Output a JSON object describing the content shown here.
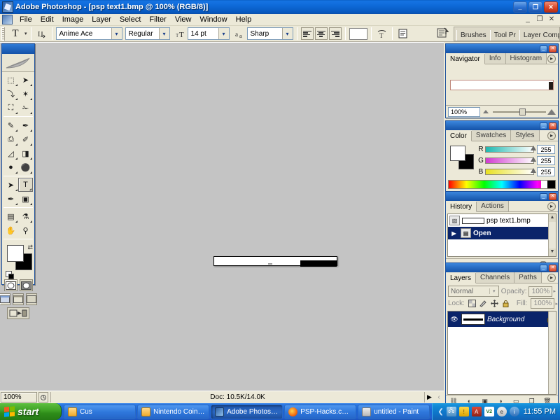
{
  "window": {
    "title": "Adobe Photoshop - [psp text1.bmp @ 100% (RGB/8)]",
    "app_icon": "photoshop-icon",
    "minimize": "_",
    "restore": "❐",
    "close": "✕"
  },
  "menubar": {
    "doc_icon": "document-icon",
    "items": [
      "File",
      "Edit",
      "Image",
      "Layer",
      "Select",
      "Filter",
      "View",
      "Window",
      "Help"
    ],
    "doc_minimize": "_",
    "doc_restore": "❐",
    "doc_close": "✕"
  },
  "options_bar": {
    "tool_glyph": "T",
    "tool_caret": "▾",
    "orientation_icon": "text-orientation-icon",
    "font_family": "Anime Ace",
    "font_style": "Regular",
    "size_icon": "font-size-icon",
    "font_size": "14 pt",
    "aa_icon": "anti-alias-icon",
    "anti_alias": "Sharp",
    "align_left": "align-left",
    "align_center": "align-center",
    "align_right": "align-right",
    "text_color": "#ffffff",
    "warp_icon": "warp-text-icon",
    "palette_icon": "character-palette-icon",
    "dock_icon": "dock-to-well-icon",
    "well_tabs": [
      "Brushes",
      "Tool Pr",
      "Layer Comps"
    ],
    "dropdown_arrow": "▾"
  },
  "toolbox": {
    "logo": "feather-logo",
    "tools": [
      {
        "name": "marquee-tool",
        "glyph": "⬚",
        "selected": false
      },
      {
        "name": "move-tool",
        "glyph": "➤",
        "selected": false
      },
      {
        "name": "lasso-tool",
        "glyph": "⤵",
        "selected": false
      },
      {
        "name": "magic-wand-tool",
        "glyph": "✶",
        "selected": false
      },
      {
        "name": "crop-tool",
        "glyph": "⛶",
        "selected": false
      },
      {
        "name": "slice-tool",
        "glyph": "✁",
        "selected": false
      },
      {
        "name": "healing-brush-tool",
        "glyph": "✎",
        "selected": false
      },
      {
        "name": "brush-tool",
        "glyph": "✒",
        "selected": false
      },
      {
        "name": "clone-stamp-tool",
        "glyph": "⎙",
        "selected": false
      },
      {
        "name": "history-brush-tool",
        "glyph": "✐",
        "selected": false
      },
      {
        "name": "eraser-tool",
        "glyph": "◿",
        "selected": false
      },
      {
        "name": "gradient-tool",
        "glyph": "◨",
        "selected": false
      },
      {
        "name": "blur-tool",
        "glyph": "●",
        "selected": false
      },
      {
        "name": "dodge-tool",
        "glyph": "⚫",
        "selected": false
      },
      {
        "name": "path-selection-tool",
        "glyph": "➤",
        "selected": false
      },
      {
        "name": "type-tool",
        "glyph": "T",
        "selected": true
      },
      {
        "name": "pen-tool",
        "glyph": "✒",
        "selected": false
      },
      {
        "name": "shape-tool",
        "glyph": "▣",
        "selected": false
      },
      {
        "name": "notes-tool",
        "glyph": "▤",
        "selected": false
      },
      {
        "name": "eyedropper-tool",
        "glyph": "⚗",
        "selected": false
      },
      {
        "name": "hand-tool",
        "glyph": "✋",
        "selected": false
      },
      {
        "name": "zoom-tool",
        "glyph": "⚲",
        "selected": false
      }
    ],
    "foreground_color": "#ffffff",
    "background_color": "#000000",
    "swap_icon": "swap-colors-icon",
    "default_icon": "default-colors-icon",
    "quickmask_standard": "standard-mode-icon",
    "quickmask_mask": "quick-mask-mode-icon",
    "screen_standard": "standard-screen-icon",
    "screen_full_menu": "full-screen-menubar-icon",
    "screen_full": "full-screen-icon",
    "jump_to_imageready": "jump-to-imageready-icon"
  },
  "canvas": {
    "document_name": "psp text1.bmp",
    "zoom": "100%",
    "mode": "RGB/8"
  },
  "statusbar": {
    "zoom": "100%",
    "grip_icon": "resize-grip-icon",
    "doc_info": "Doc: 10.5K/14.0K",
    "arrow": "▶"
  },
  "panels": {
    "navigator": {
      "tabs": [
        "Navigator",
        "Info",
        "Histogram"
      ],
      "active_tab": "Navigator",
      "menu_icon": "panel-menu-icon",
      "zoom_value": "100%",
      "zoom_out_icon": "zoom-out-icon",
      "zoom_in_icon": "zoom-in-icon"
    },
    "color": {
      "tabs": [
        "Color",
        "Swatches",
        "Styles"
      ],
      "active_tab": "Color",
      "menu_icon": "panel-menu-icon",
      "foreground": "#ffffff",
      "background": "#000000",
      "channels": [
        {
          "label": "R",
          "value": "255"
        },
        {
          "label": "G",
          "value": "255"
        },
        {
          "label": "B",
          "value": "255"
        }
      ]
    },
    "history": {
      "tabs": [
        "History",
        "Actions"
      ],
      "active_tab": "History",
      "menu_icon": "panel-menu-icon",
      "snapshot": "psp text1.bmp",
      "states": [
        {
          "label": "Open",
          "selected": true
        }
      ],
      "footer_icons": [
        "new-document-from-state-icon",
        "new-snapshot-icon",
        "delete-state-icon"
      ]
    },
    "layers": {
      "tabs": [
        "Layers",
        "Channels",
        "Paths"
      ],
      "active_tab": "Layers",
      "menu_icon": "panel-menu-icon",
      "blend_mode": "Normal",
      "opacity_label": "Opacity:",
      "opacity_value": "100%",
      "lock_label": "Lock:",
      "lock_icons": [
        "lock-transparency-icon",
        "lock-image-icon",
        "lock-position-icon",
        "lock-all-icon"
      ],
      "fill_label": "Fill:",
      "fill_value": "100%",
      "rows": [
        {
          "name": "Background",
          "visible": true,
          "locked": true,
          "selected": true
        }
      ],
      "footer_icons": [
        "link-layers-icon",
        "layer-style-icon",
        "layer-mask-icon",
        "adjustment-layer-icon",
        "new-group-icon",
        "new-layer-icon",
        "delete-layer-icon"
      ]
    }
  },
  "taskbar": {
    "start_label": "start",
    "tasks": [
      {
        "label": "Cus",
        "icon": "folder-icon",
        "active": false
      },
      {
        "label": "Nintendo Coin XM...",
        "icon": "folder-icon",
        "active": false
      },
      {
        "label": "Adobe Photoshop ...",
        "icon": "photoshop-icon",
        "active": true
      },
      {
        "label": "PSP-Hacks.com / ...",
        "icon": "firefox-icon",
        "active": false
      },
      {
        "label": "untitled - Paint",
        "icon": "paint-icon",
        "active": false
      }
    ],
    "tray_chevron": "❮",
    "tray_icons": [
      "network-icon",
      "shield-icon",
      "antivirus-icon",
      "volume-icon",
      "messenger-icon",
      "info-icon"
    ],
    "clock": "11:55 PM"
  }
}
